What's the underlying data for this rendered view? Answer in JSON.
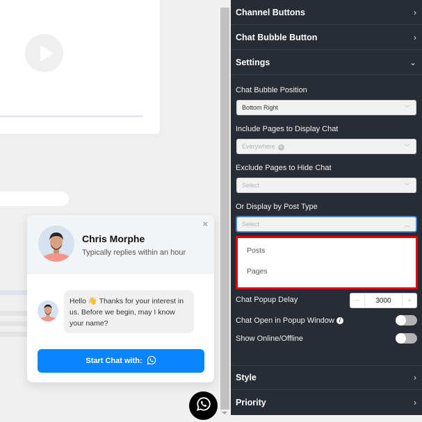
{
  "preview": {
    "video_play_icon": "play-icon"
  },
  "chat_widget": {
    "agent_name": "Chris Morphe",
    "agent_status": "Typically replies within an hour",
    "close_icon": "×",
    "message": "Hello 👋 Thanks for your interest in us. Before we begin, may I know your name?",
    "start_button_label": "Start Chat with:",
    "start_button_icon": "whatsapp-icon",
    "fab_icon": "whatsapp-icon"
  },
  "panel": {
    "sections": [
      {
        "label": "Channel Buttons",
        "icon": "›"
      },
      {
        "label": "Chat Bubble Button",
        "icon": "›"
      },
      {
        "label": "Settings",
        "icon": "⌄"
      },
      {
        "label": "Style",
        "icon": "›"
      },
      {
        "label": "Priority",
        "icon": "›"
      }
    ],
    "settings": {
      "bubble_position_label": "Chat Bubble Position",
      "bubble_position_value": "Bottom Right",
      "include_pages_label": "Include Pages to Display Chat",
      "include_pages_tag": "Everywhere",
      "exclude_pages_label": "Exclude Pages to Hide Chat",
      "exclude_pages_placeholder": "Select",
      "post_type_label": "Or Display by Post Type",
      "post_type_placeholder": "Select",
      "post_type_options": [
        "Posts",
        "Pages"
      ],
      "popup_delay_label": "Chat Popup Delay",
      "popup_delay_value": "3000",
      "stepper_minus": "−",
      "stepper_plus": "+",
      "popup_window_label": "Chat Open in Popup Window",
      "popup_window_enabled": false,
      "online_offline_label": "Show Online/Offline",
      "online_offline_enabled": false
    }
  },
  "colors": {
    "panel_bg": "#282c34",
    "accent_blue": "#0a84ff",
    "highlight_red": "#e60000"
  }
}
